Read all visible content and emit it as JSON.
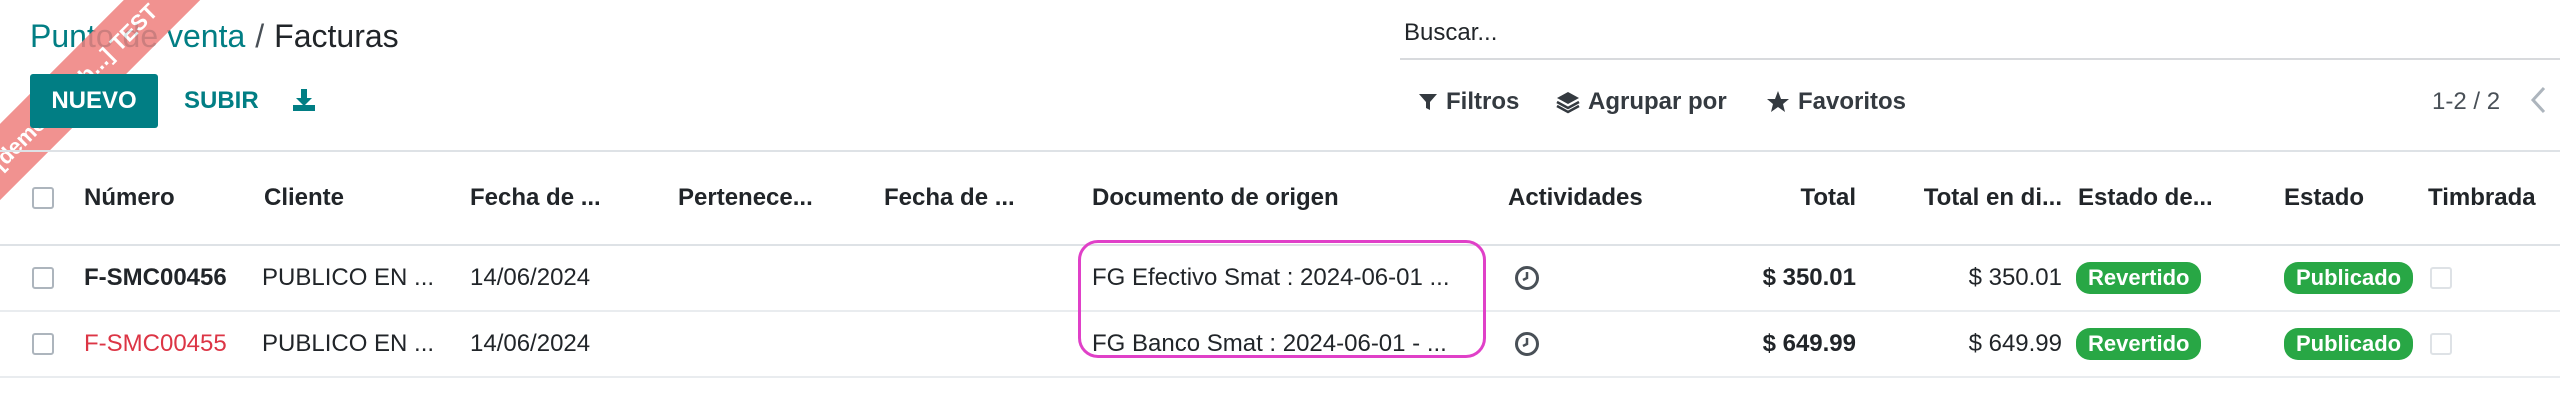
{
  "breadcrumb": {
    "parent": "Punto de venta",
    "separator": "/",
    "current": "Facturas"
  },
  "search": {
    "placeholder": "Buscar..."
  },
  "toolbar": {
    "new_label": "NUEVO",
    "upload_label": "SUBIR",
    "download_icon": "download-icon"
  },
  "filters": {
    "filters_label": "Filtros",
    "group_label": "Agrupar por",
    "favorites_label": "Favoritos"
  },
  "pager": {
    "range": "1-2 / 2",
    "prev_icon": "chevron-left-icon"
  },
  "ribbon": {
    "text": "[demo-terrab...] TEST"
  },
  "table": {
    "headers": [
      "Número",
      "Cliente",
      "Fecha de ...",
      "Pertenece...",
      "Fecha de ...",
      "Documento de origen",
      "Actividades",
      "Total",
      "Total en di...",
      "Estado de...",
      "Estado",
      "Timbrada"
    ],
    "rows": [
      {
        "numero": "F-SMC00456",
        "cliente": "PUBLICO EN ...",
        "fecha": "14/06/2024",
        "pertenece": "",
        "fecha2": "",
        "origen": "FG Efectivo Smat : 2024-06-01 ...",
        "total": "$ 350.01",
        "total_div": "$ 350.01",
        "estado_pago": "Revertido",
        "estado": "Publicado",
        "overdue": false
      },
      {
        "numero": "F-SMC00455",
        "cliente": "PUBLICO EN ...",
        "fecha": "14/06/2024",
        "pertenece": "",
        "fecha2": "",
        "origen": "FG Banco Smat : 2024-06-01 - ...",
        "total": "$ 649.99",
        "total_div": "$ 649.99",
        "estado_pago": "Revertido",
        "estado": "Publicado",
        "overdue": true
      }
    ]
  },
  "colors": {
    "primary": "#017e84",
    "success": "#28a745",
    "danger": "#dc3545",
    "highlight": "#e040c8"
  }
}
